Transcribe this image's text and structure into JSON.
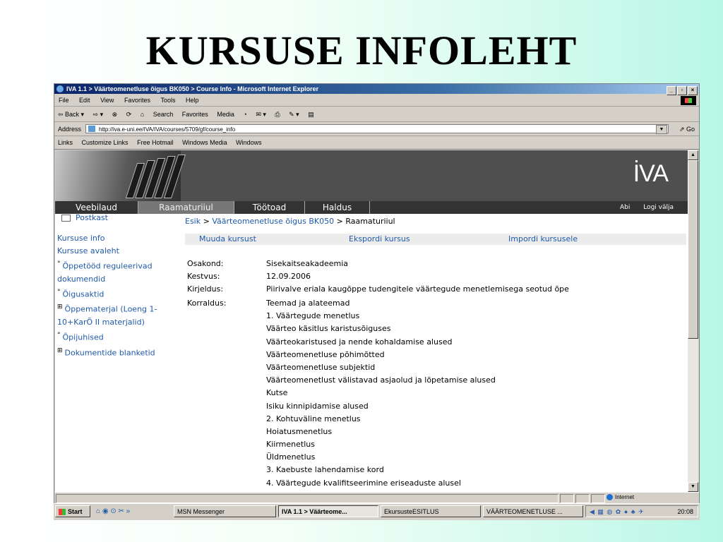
{
  "slide": {
    "title": "KURSUSE INFOLEHT"
  },
  "window": {
    "title": "IVA 1.1 > Väärteomenetluse õigus BK050 > Course Info - Microsoft Internet Explorer",
    "controls": [
      "_",
      "▫",
      "×"
    ]
  },
  "menubar": [
    "File",
    "Edit",
    "View",
    "Favorites",
    "Tools",
    "Help"
  ],
  "toolbar": {
    "back": "⇦ Back ▾",
    "forward": "⇨ ▾",
    "stop": "⊗",
    "refresh": "⟳",
    "home": "⌂",
    "search": "Search",
    "favorites": "Favorites",
    "media": "Media",
    "history": "◔",
    "mail": "✉ ▾",
    "print": "⎙",
    "edit": "✎ ▾",
    "discuss": "▤"
  },
  "address": {
    "label": "Address",
    "url": "http://iva.e-uni.ee/IVA/IVA/courses/5709/gf/course_info",
    "go": "Go"
  },
  "links": {
    "label": "Links",
    "items": [
      "Customize Links",
      "Free Hotmail",
      "Windows Media",
      "Windows"
    ]
  },
  "banner": {
    "brand": "İVA"
  },
  "nav": {
    "tabs": [
      "Veebilaud",
      "Raamaturiiul",
      "Töötoad",
      "Haldus"
    ],
    "active_tab": "Raamaturiiul",
    "right_links": [
      "Abi",
      "Logi välja"
    ]
  },
  "sidebar": {
    "postkast": "Postkast",
    "links": [
      "Kursuse info",
      "Kursuse avaleht"
    ],
    "tree": [
      {
        "marker": "°",
        "label": "Õppetööd reguleerivad dokumendid"
      },
      {
        "marker": "°",
        "label": "Õigusaktid"
      },
      {
        "marker": "⊞",
        "label": "Õppematerjal (Loeng 1-10+KarÕ II materjalid)"
      },
      {
        "marker": "°",
        "label": "Õpijuhised"
      },
      {
        "marker": "⊞",
        "label": "Dokumentide blanketid"
      }
    ]
  },
  "breadcrumb": {
    "home": "Esik",
    "course": "Väärteomenetluse õigus BK050",
    "current": "Raamaturiiul",
    "separator": ">"
  },
  "actions": [
    "Muuda kursust",
    "Ekspordi kursus",
    "Impordi kursusele"
  ],
  "course": {
    "osakond_label": "Osakond:",
    "osakond": "Sisekaitseakadeemia",
    "kestvus_label": "Kestvus:",
    "kestvus": "12.09.2006",
    "kirjeldus_label": "Kirjeldus:",
    "kirjeldus": "Piirivalve eriala kaugõppe tudengitele väärtegude menetlemisega seotud õpe",
    "korraldus_label": "Korraldus:",
    "korraldus": [
      "Teemad ja alateemad",
      "1. Väärtegude menetlus",
      "Väärteo käsitlus karistusõiguses",
      "Väärteokaristused ja nende kohaldamise alused",
      "Väärteomenetluse põhimõtted",
      "Väärteomenetluse subjektid",
      "Väärteomenetlust välistavad asjaolud ja lõpetamise alused",
      "Kutse",
      "Isiku kinnipidamise alused",
      "2. Kohtuväline menetlus",
      "Hoiatusmenetlus",
      "Kiirmenetlus",
      "Üldmenetlus",
      "3. Kaebuste lahendamise kord",
      "4. Väärtegude kvalifitseerimine eriseaduste alusel"
    ]
  },
  "statusbar": {
    "zone": "Internet"
  },
  "taskbar": {
    "start": "Start",
    "quicklaunch": "⌂ ◉ ⊙ ✂ »",
    "buttons": [
      "MSN Messenger",
      "IVA 1.1 > Väärteome...",
      "EkursusteESITLUS",
      "VÄÄRTEOMENETLUSE ..."
    ],
    "active_button": "IVA 1.1 > Väärteome...",
    "tray_icons": "◀ ▦ ◍ ✿ ● ♣ ✈",
    "clock": "20:08"
  }
}
